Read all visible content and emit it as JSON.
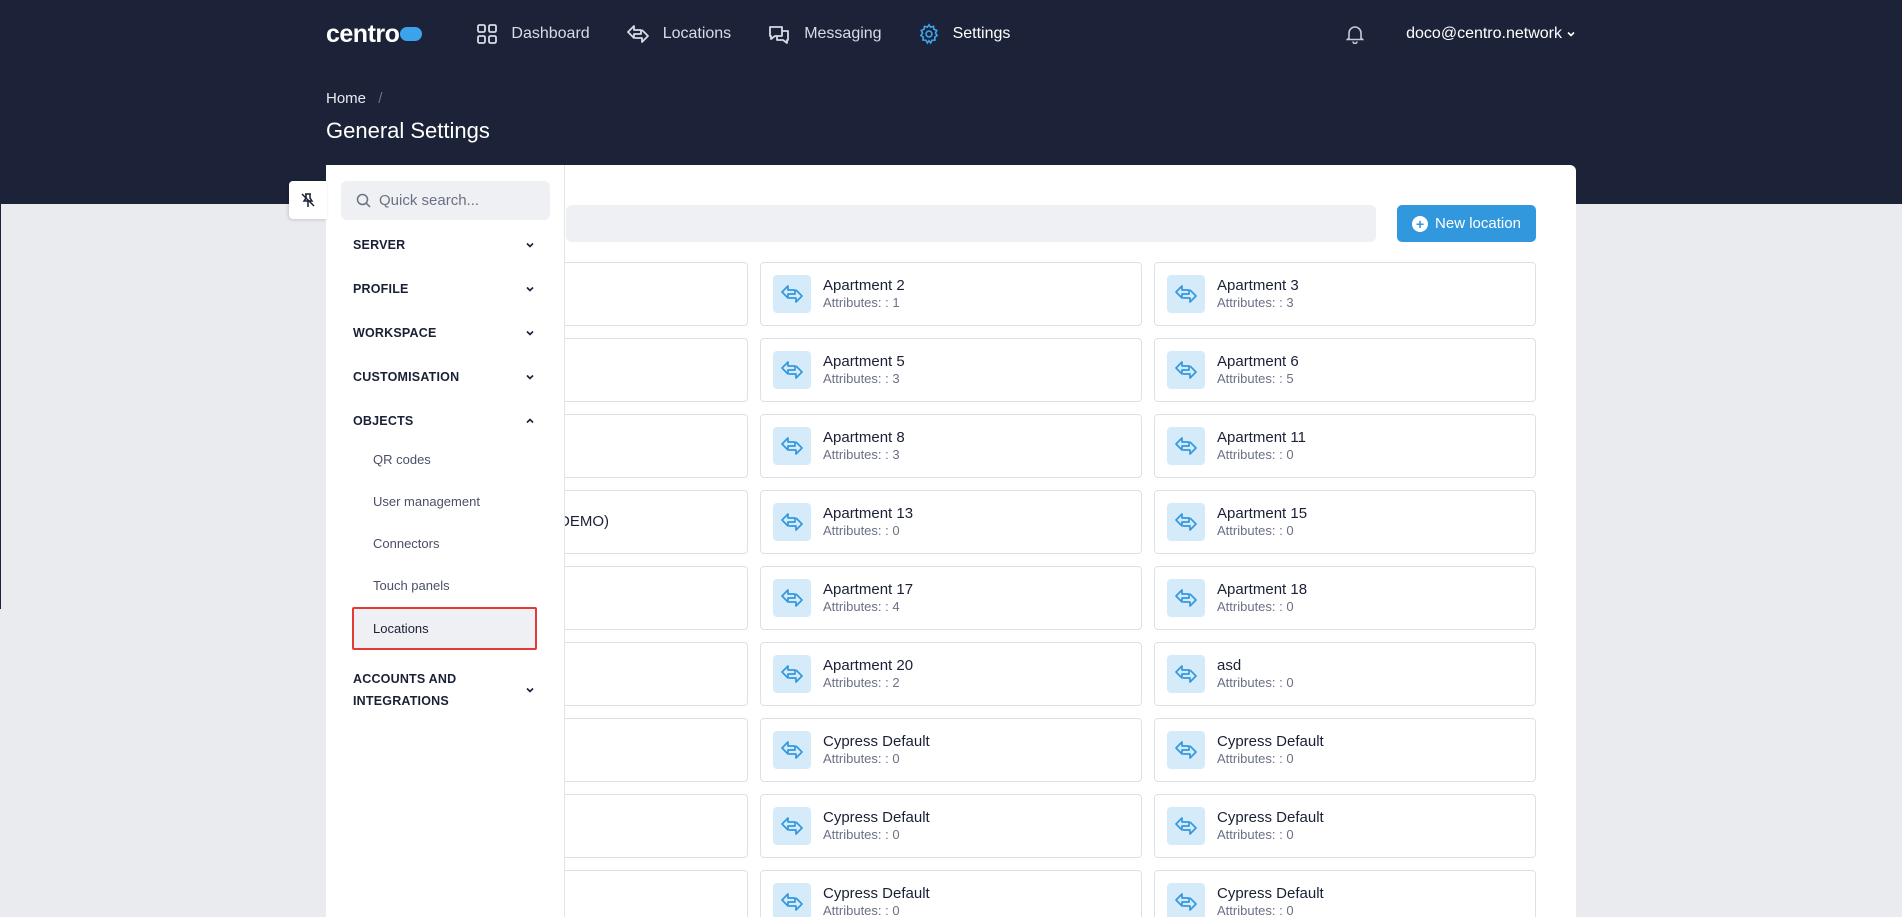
{
  "app": {
    "logo_text": "centro",
    "accent": "#3298de",
    "nav_bg": "#1c2238"
  },
  "nav": {
    "items": [
      {
        "label": "Dashboard",
        "icon": "grid-icon"
      },
      {
        "label": "Locations",
        "icon": "arrows-icon"
      },
      {
        "label": "Messaging",
        "icon": "chat-icon"
      },
      {
        "label": "Settings",
        "icon": "gear-icon"
      }
    ],
    "user": "doco@centro.network"
  },
  "breadcrumb": {
    "home": "Home",
    "sep": "/"
  },
  "page": {
    "title": "General Settings"
  },
  "toolbar": {
    "new_location": "New location"
  },
  "sidebar": {
    "search_placeholder": "Quick search...",
    "sections": [
      "SERVER",
      "PROFILE",
      "WORKSPACE",
      "CUSTOMISATION",
      "OBJECTS",
      "ACCOUNTS AND",
      "INTEGRATIONS"
    ],
    "objects_items": [
      "QR codes",
      "User management",
      "Connectors",
      "Touch panels",
      "Locations"
    ]
  },
  "locations": [
    {
      "name": "",
      "attr": ""
    },
    {
      "name": "Apartment 2",
      "attr": "Attributes: : 1"
    },
    {
      "name": "Apartment 3",
      "attr": "Attributes: : 3"
    },
    {
      "name": "",
      "attr": ""
    },
    {
      "name": "Apartment 5",
      "attr": "Attributes: : 3"
    },
    {
      "name": "Apartment 6",
      "attr": "Attributes: : 5"
    },
    {
      "name": "",
      "attr": ""
    },
    {
      "name": "Apartment 8",
      "attr": "Attributes: : 3"
    },
    {
      "name": "Apartment 11",
      "attr": "Attributes: : 0"
    },
    {
      "name": "DEMO)",
      "attr": ""
    },
    {
      "name": "Apartment 13",
      "attr": "Attributes: : 0"
    },
    {
      "name": "Apartment 15",
      "attr": "Attributes: : 0"
    },
    {
      "name": "",
      "attr": ""
    },
    {
      "name": "Apartment 17",
      "attr": "Attributes: : 4"
    },
    {
      "name": "Apartment 18",
      "attr": "Attributes: : 0"
    },
    {
      "name": "",
      "attr": ""
    },
    {
      "name": "Apartment 20",
      "attr": "Attributes: : 2"
    },
    {
      "name": "asd",
      "attr": "Attributes: : 0"
    },
    {
      "name": "",
      "attr": ""
    },
    {
      "name": "Cypress Default",
      "attr": "Attributes: : 0"
    },
    {
      "name": "Cypress Default",
      "attr": "Attributes: : 0"
    },
    {
      "name": "",
      "attr": ""
    },
    {
      "name": "Cypress Default",
      "attr": "Attributes: : 0"
    },
    {
      "name": "Cypress Default",
      "attr": "Attributes: : 0"
    },
    {
      "name": "",
      "attr": ""
    },
    {
      "name": "Cypress Default",
      "attr": "Attributes: : 0"
    },
    {
      "name": "Cypress Default",
      "attr": "Attributes: : 0"
    }
  ]
}
